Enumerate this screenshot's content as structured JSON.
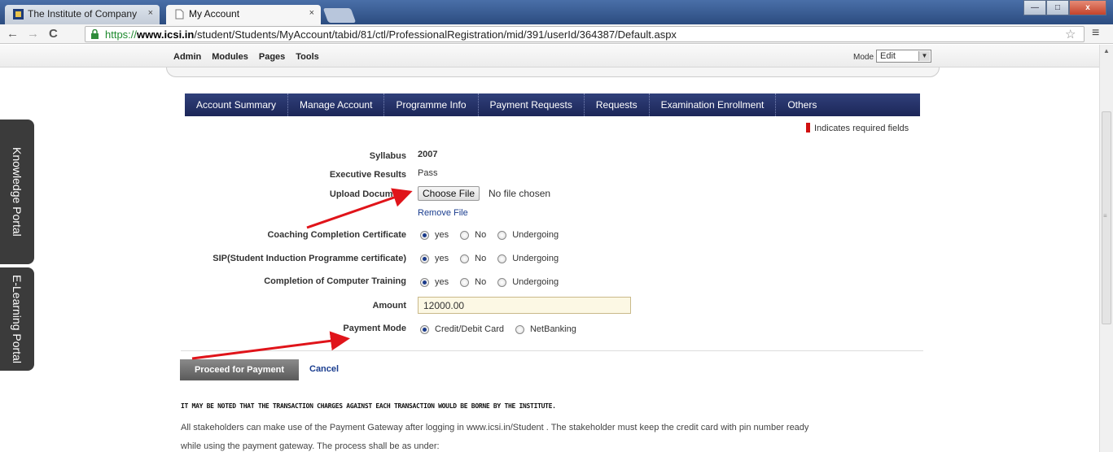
{
  "browser": {
    "tabs": [
      {
        "title": "The Institute of Company"
      },
      {
        "title": "My Account"
      }
    ],
    "tab_close": "×",
    "window_buttons": {
      "minimize": "—",
      "maximize": "□",
      "close": "x"
    },
    "url": {
      "scheme": "https://",
      "domain": "www.icsi.in",
      "path": "/student/Students/MyAccount/tabid/81/ctl/ProfessionalRegistration/mid/391/userId/364387/Default.aspx"
    },
    "nav": {
      "back": "←",
      "forward": "→",
      "reload": "C"
    },
    "star": "☆",
    "menu": "≡"
  },
  "admin_bar": {
    "items": [
      "Admin",
      "Modules",
      "Pages",
      "Tools"
    ],
    "mode_label": "Mode",
    "mode_value": "Edit"
  },
  "nav_menu": [
    "Account Summary",
    "Manage Account",
    "Programme Info",
    "Payment Requests",
    "Requests",
    "Examination Enrollment",
    "Others"
  ],
  "required_note": "Indicates required fields",
  "form": {
    "syllabus": {
      "label": "Syllabus",
      "value": "2007"
    },
    "executive_results": {
      "label": "Executive Results",
      "value": "Pass"
    },
    "upload_document": {
      "label": "Upload Document",
      "button": "Choose File",
      "status": "No file chosen",
      "remove": "Remove File"
    },
    "coaching": {
      "label": "Coaching Completion Certificate",
      "options": [
        "yes",
        "No",
        "Undergoing"
      ],
      "selected": "yes"
    },
    "sip": {
      "label": "SIP(Student Induction Programme certificate)",
      "options": [
        "yes",
        "No",
        "Undergoing"
      ],
      "selected": "yes"
    },
    "computer_training": {
      "label": "Completion of Computer Training",
      "options": [
        "yes",
        "No",
        "Undergoing"
      ],
      "selected": "yes"
    },
    "amount": {
      "label": "Amount",
      "value": "12000.00"
    },
    "payment_mode": {
      "label": "Payment Mode",
      "options": [
        "Credit/Debit Card",
        "NetBanking"
      ],
      "selected": "Credit/Debit Card"
    }
  },
  "actions": {
    "proceed": "Proceed for Payment",
    "cancel": "Cancel"
  },
  "notice": "IT MAY BE NOTED THAT THE TRANSACTION CHARGES AGAINST EACH TRANSACTION WOULD BE BORNE BY THE INSTITUTE.",
  "paragraph_lines": [
    "All stakeholders can make use of the Payment Gateway after logging in www.icsi.in/Student . The stakeholder must keep the credit card with pin number ready",
    "while using the payment gateway. The process shall be as under:"
  ],
  "side_portals": [
    "Knowledge Portal",
    "E-Learning Portal"
  ],
  "colors": {
    "nav_bg": "#1c2658",
    "required": "#d01010",
    "annotation_arrow": "#e0141a",
    "link": "#1a3d8f"
  }
}
